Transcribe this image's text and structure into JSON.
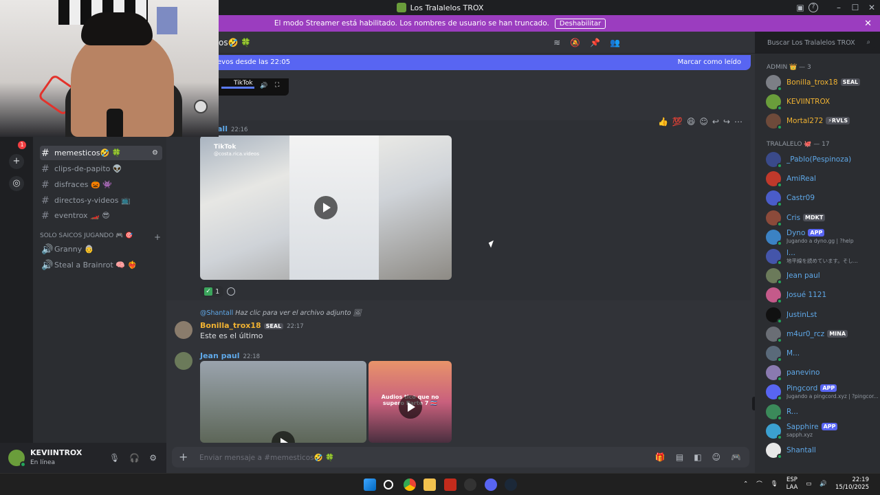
{
  "window": {
    "title": "Los Tralalelos TROX"
  },
  "streamer": {
    "message": "El modo Streamer está habilitado. Los nombres de usuario se han truncado.",
    "button": "Deshabilitar"
  },
  "channel_header": {
    "name": "os🤣 🍀"
  },
  "search": {
    "placeholder": "Buscar Los Tralalelos TROX"
  },
  "new_messages": {
    "text": "evos desde las 22:05",
    "mark_read": "Marcar como leído"
  },
  "guild_badge": "1",
  "channels": [
    {
      "name": "memesticos🤣 🍀",
      "active": true
    },
    {
      "name": "clips-de-papito 👽"
    },
    {
      "name": "disfraces 🎃 👾"
    },
    {
      "name": "directos-y-videos 📺"
    },
    {
      "name": "eventrox 🏎️ 😎"
    }
  ],
  "category": {
    "name": "SOLO SAICOS JUGANDO 🎮 🎯"
  },
  "voice_channels": [
    {
      "name": "Granny 👵"
    },
    {
      "name": "Steal a Brainrot 🧠 ❤️‍🔥"
    }
  ],
  "user_panel": {
    "name": "KEVIINTROX",
    "status": "En línea"
  },
  "messages": {
    "top_video_label": "TikTok",
    "msg1": {
      "author": "all",
      "time": "22:16",
      "video_label": "TikTok",
      "video_handle": "@costa.rica.videos",
      "reaction_count": "1"
    },
    "reply": {
      "mention": "@Shantall",
      "text": "Haz clic para ver el archivo adjunto"
    },
    "msg2": {
      "author": "Bonilla_trox18",
      "tag": "SEAL",
      "time": "22:17",
      "text": "Este es el último"
    },
    "msg3": {
      "author": "Jean paul",
      "time": "22:18",
      "video2_caption": "Audios tico que no supero Parte 7 🇨🇷"
    }
  },
  "composer": {
    "placeholder": "Enviar mensaje a #memesticos🤣 🍀"
  },
  "members": {
    "admin_header": "ADMIN 👑 — 3",
    "admins": [
      {
        "name": "Bonilla_trox18",
        "tag": "SEAL",
        "color": "#f0b232"
      },
      {
        "name": "KEVIINTROX",
        "color": "#f0b232"
      },
      {
        "name": "Mortal272",
        "tag": "⚡RVLS",
        "color": "#f0b232"
      }
    ],
    "group_header": "TRALALELO 🐙 — 17",
    "list": [
      {
        "name": "_Pablo(Pespinoza)"
      },
      {
        "name": "AmiReal"
      },
      {
        "name": "Castr09"
      },
      {
        "name": "Cris",
        "tag": "MDKT"
      },
      {
        "name": "Dyno",
        "app": "APP",
        "status": "Jugando a dyno.gg | ?help"
      },
      {
        "name": "l...",
        "status": "地平線を読めています。そし..."
      },
      {
        "name": "Jean paul"
      },
      {
        "name": "Josué 1121"
      },
      {
        "name": "JustinLst"
      },
      {
        "name": "m4ur0_rcz",
        "tag": "MINA"
      },
      {
        "name": "M..."
      },
      {
        "name": "panevino"
      },
      {
        "name": "Pingcord",
        "app": "APP",
        "status": "Jugando a pingcord.xyz | ?pingcor..."
      },
      {
        "name": "R..."
      },
      {
        "name": "Sapphire",
        "app": "APP",
        "status": "sapph.xyz"
      },
      {
        "name": "Shantall"
      }
    ]
  },
  "taskbar": {
    "lang": "ESP",
    "lang2": "LAA",
    "time": "22:19",
    "date": "15/10/2025"
  },
  "colors": {
    "accent": "#5865f2",
    "streamer": "#9b3dbf",
    "name_blue": "#5fa8e8",
    "admin": "#f0b232"
  }
}
